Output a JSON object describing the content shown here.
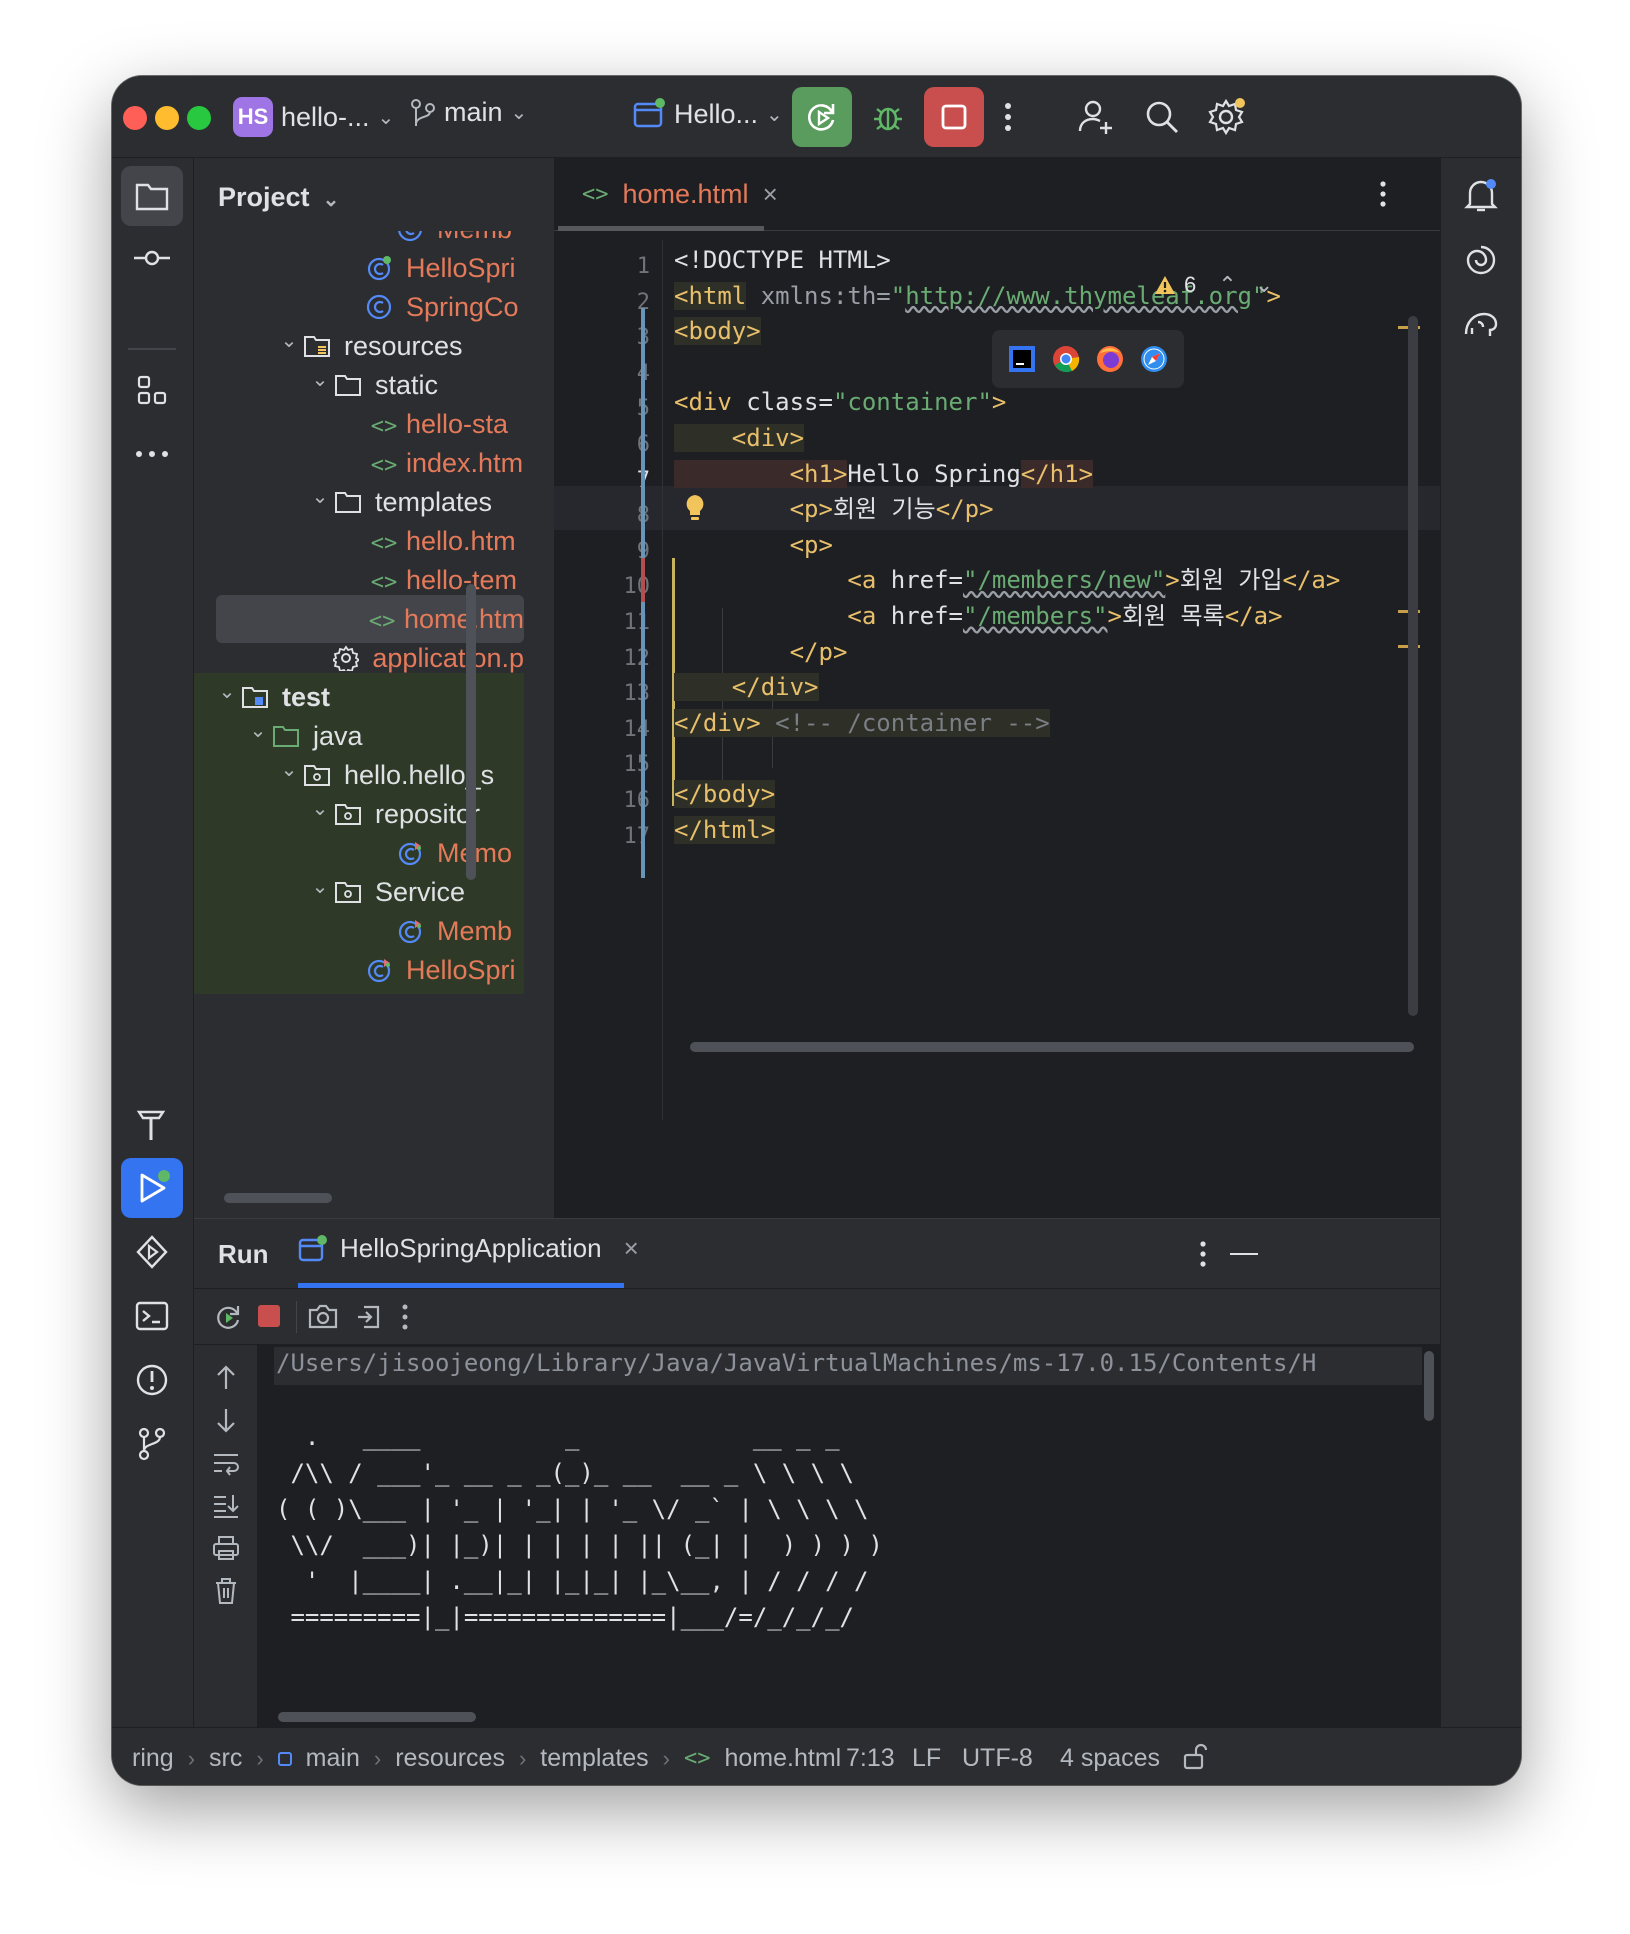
{
  "titlebar": {
    "project_badge": "HS",
    "project_name": "hello-...",
    "branch": "main",
    "run_config": "Hello..."
  },
  "project_panel": {
    "title": "Project",
    "tree": [
      {
        "label": "Memb",
        "kind": "class",
        "level": 5,
        "color": "orange"
      },
      {
        "label": "HelloSpri",
        "kind": "spring-class",
        "level": 4,
        "color": "orange"
      },
      {
        "label": "SpringCo",
        "kind": "class",
        "level": 4,
        "color": "orange"
      },
      {
        "label": "resources",
        "kind": "resources-folder",
        "level": 2,
        "color": "white",
        "expanded": true
      },
      {
        "label": "static",
        "kind": "folder",
        "level": 3,
        "color": "white",
        "expanded": true
      },
      {
        "label": "hello-sta",
        "kind": "html",
        "level": 4,
        "color": "orange"
      },
      {
        "label": "index.htm",
        "kind": "html",
        "level": 4,
        "color": "orange"
      },
      {
        "label": "templates",
        "kind": "folder",
        "level": 3,
        "color": "white",
        "expanded": true
      },
      {
        "label": "hello.htm",
        "kind": "html",
        "level": 4,
        "color": "orange"
      },
      {
        "label": "hello-tem",
        "kind": "html",
        "level": 4,
        "color": "orange"
      },
      {
        "label": "home.htm",
        "kind": "html",
        "level": 4,
        "color": "orange",
        "selected": true
      },
      {
        "label": "application.p",
        "kind": "settings",
        "level": 3,
        "color": "orange"
      },
      {
        "label": "test",
        "kind": "test-folder",
        "level": 0,
        "color": "white",
        "expanded": true,
        "bold": true,
        "test": true
      },
      {
        "label": "java",
        "kind": "test-java-folder",
        "level": 1,
        "color": "white",
        "expanded": true,
        "test": true
      },
      {
        "label": "hello.hello_s",
        "kind": "package",
        "level": 2,
        "color": "white",
        "expanded": true,
        "test": true
      },
      {
        "label": "repositor",
        "kind": "package",
        "level": 3,
        "color": "white",
        "expanded": true,
        "test": true
      },
      {
        "label": "Memo",
        "kind": "test-class",
        "level": 5,
        "color": "orange",
        "test": true
      },
      {
        "label": "Service",
        "kind": "package",
        "level": 3,
        "color": "white",
        "expanded": true,
        "test": true
      },
      {
        "label": "Memb",
        "kind": "test-class",
        "level": 5,
        "color": "orange",
        "test": true
      },
      {
        "label": "HelloSpri",
        "kind": "test-class",
        "level": 4,
        "color": "orange",
        "test": true
      }
    ]
  },
  "editor": {
    "tab_label": "home.html",
    "warnings_count": "6",
    "current_line": "7",
    "line_numbers": [
      "1",
      "2",
      "3",
      "4",
      "5",
      "6",
      "7",
      "8",
      "9",
      "10",
      "11",
      "12",
      "13",
      "14",
      "15",
      "16",
      "17"
    ],
    "lines": [
      [
        [
          "<!DOCTYPE HTML>",
          "#dfe1e5"
        ]
      ],
      [
        [
          "<html",
          "#e8bf6a"
        ],
        [
          " xmlns:th=",
          "#9a9ea6"
        ],
        [
          "\"",
          "#6aab73"
        ],
        [
          "http://www.thymeleaf.org",
          "#6aab73"
        ],
        [
          "\"",
          "#6aab73"
        ],
        [
          ">",
          "#e8bf6a"
        ]
      ],
      [
        [
          "<body>",
          "#e8bf6a"
        ]
      ],
      [],
      [
        [
          "<div",
          "#e8bf6a"
        ],
        [
          " class=",
          "#dfe1e5"
        ],
        [
          "\"container\"",
          "#6aab73"
        ],
        [
          ">",
          "#e8bf6a"
        ]
      ],
      [
        [
          "    <div>",
          "#e8bf6a"
        ]
      ],
      [
        [
          "        <h1>",
          "#e8bf6a"
        ],
        [
          "Hello Spring",
          "#dfe1e5"
        ],
        [
          "</h1>",
          "#e8bf6a"
        ]
      ],
      [
        [
          "        <p>",
          "#e8bf6a"
        ],
        [
          "회원 기능",
          "#dfe1e5"
        ],
        [
          "</p>",
          "#e8bf6a"
        ]
      ],
      [
        [
          "        <p>",
          "#e8bf6a"
        ]
      ],
      [
        [
          "            <a",
          "#e8bf6a"
        ],
        [
          " href=",
          "#dfe1e5"
        ],
        [
          "\"/members/new\"",
          "#6aab73"
        ],
        [
          ">",
          "#e8bf6a"
        ],
        [
          "회원 가입",
          "#dfe1e5"
        ],
        [
          "</a>",
          "#e8bf6a"
        ]
      ],
      [
        [
          "            <a",
          "#e8bf6a"
        ],
        [
          " href=",
          "#dfe1e5"
        ],
        [
          "\"/members\"",
          "#6aab73"
        ],
        [
          ">",
          "#e8bf6a"
        ],
        [
          "회원 목록",
          "#dfe1e5"
        ],
        [
          "</a>",
          "#e8bf6a"
        ]
      ],
      [
        [
          "        </p>",
          "#e8bf6a"
        ]
      ],
      [
        [
          "    </div>",
          "#e8bf6a"
        ]
      ],
      [
        [
          "</div>",
          "#e8bf6a"
        ],
        [
          " <!-- /container -->",
          "#7a7e85"
        ]
      ],
      [],
      [
        [
          "</body>",
          "#e8bf6a"
        ]
      ],
      [
        [
          "</html>",
          "#e8bf6a"
        ]
      ]
    ]
  },
  "run_panel": {
    "title": "Run",
    "tab_label": "HelloSpringApplication",
    "console": [
      "/Users/jisoojeong/Library/Java/JavaVirtualMachines/ms-17.0.15/Contents/H",
      "",
      "  .   ____          _            __ _ _",
      " /\\\\ / ___'_ __ _ _(_)_ __  __ _ \\ \\ \\ \\",
      "( ( )\\___ | '_ | '_| | '_ \\/ _` | \\ \\ \\ \\",
      " \\\\/  ___)| |_)| | | | | || (_| |  ) ) ) )",
      "  '  |____| .__|_| |_|_| |_\\__, | / / / /",
      " =========|_|==============|___/=/_/_/_/"
    ]
  },
  "statusbar": {
    "breadcrumbs": [
      "ring",
      "src",
      "main",
      "resources",
      "templates",
      "home.html"
    ],
    "position": "7:13",
    "line_sep": "LF",
    "encoding": "UTF-8",
    "indent": "4 spaces"
  },
  "colors": {
    "accent_blue": "#3574f0",
    "run_green": "#5a9c5d",
    "stop_red": "#c94f4f",
    "html_tag": "#e8bf6a",
    "string": "#6aab73",
    "file_modified": "#e47a5a"
  }
}
